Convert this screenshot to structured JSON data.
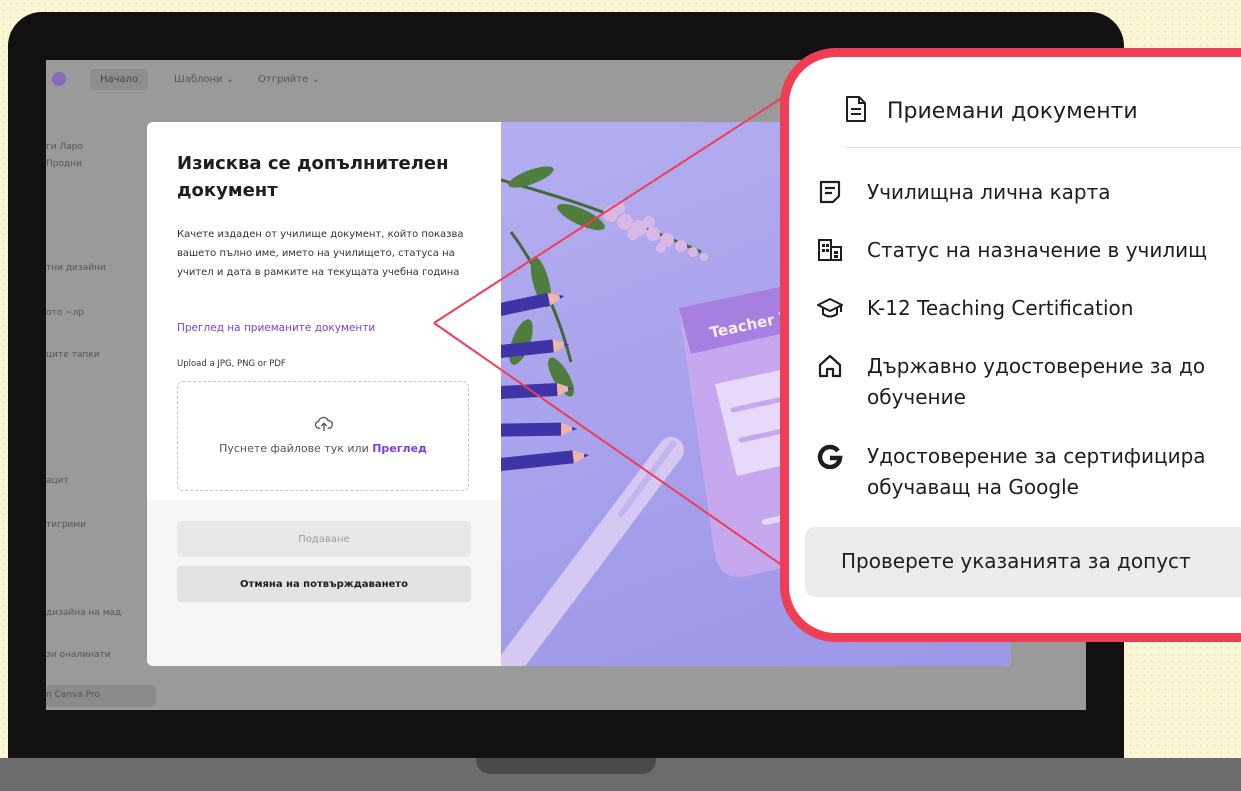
{
  "background_app": {
    "tabs": [
      "Начало",
      "Шаблони ⌄",
      "Отгрийте ⌄"
    ],
    "sidebar": [
      "ги Ларо",
      "Продни",
      "тни дизайни",
      "ото ~лр",
      "ците тапки",
      "ацит",
      "тигрими",
      "дизайна на мад",
      "зи оналинати",
      "n Canva Pro"
    ]
  },
  "dialog": {
    "title": "Изисква се допълнителен документ",
    "description": "Качете издаден от училище документ, който показва вашето пълно име, името на училището, статуса на учител и дата в рамките на текущата учебна година",
    "link": "Преглед на приеманите документи",
    "upload_label": "Upload a JPG, PNG or PDF",
    "dropzone_text": "Пуснете файлове тук или",
    "dropzone_browse": "Преглед",
    "submit_label": "Подаване",
    "cancel_label": "Отмяна на потвърждаването"
  },
  "artwork": {
    "card_text": "Teacher V"
  },
  "callout": {
    "title": "Приемани документи",
    "items": [
      {
        "label": "Училищна лична карта",
        "icon": "id-card-icon"
      },
      {
        "label": "Статус на назначение в училищ",
        "icon": "building-icon"
      },
      {
        "label": "K-12 Teaching Certification",
        "icon": "graduation-cap-icon"
      },
      {
        "label": "Държавно удостоверение за до обучение",
        "icon": "house-icon"
      },
      {
        "label": "Удостоверение за сертифицира обучаващ на Google",
        "icon": "google-icon"
      }
    ],
    "button": "Проверете указанията за допуст"
  },
  "colors": {
    "accent": "#7d3ee6",
    "callout_border": "#ef3e53",
    "artwork_bg": "#a7a0ec"
  }
}
